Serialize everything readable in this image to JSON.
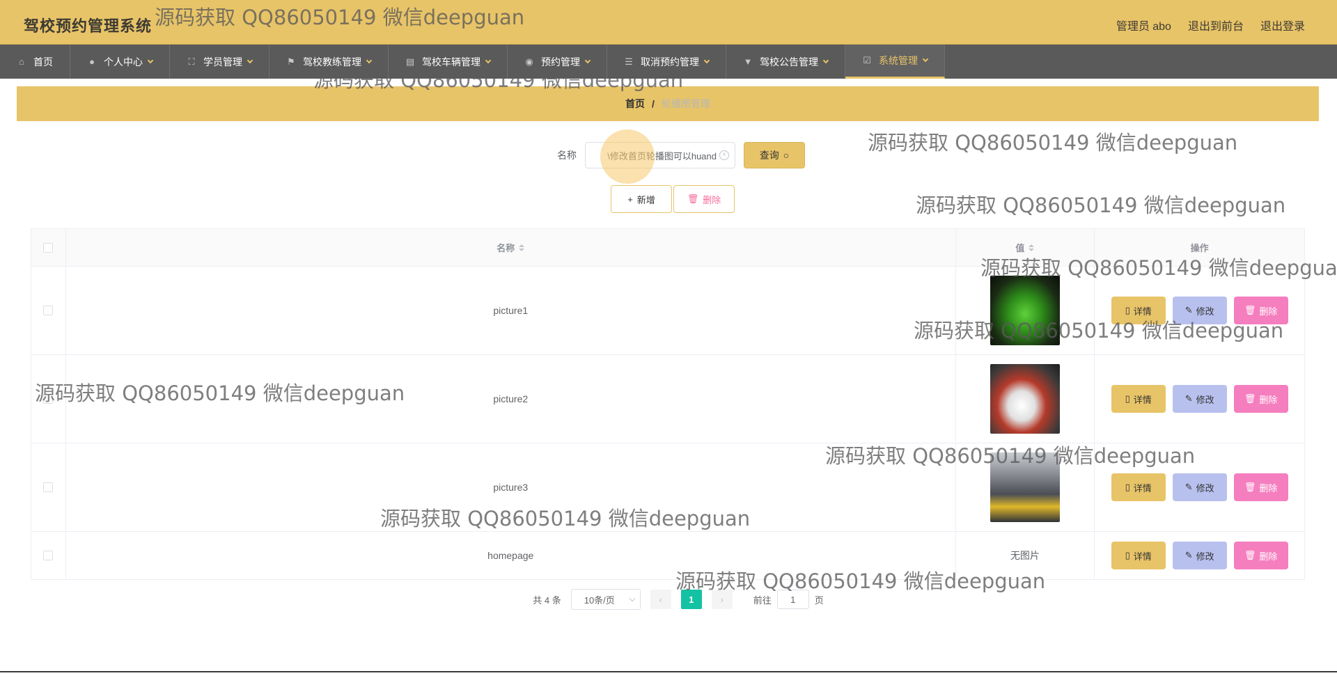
{
  "header": {
    "app_title": "驾校预约管理系统",
    "user_label": "管理员 abo",
    "to_frontend": "退出到前台",
    "logout": "退出登录"
  },
  "nav": {
    "items": [
      {
        "label": "首页",
        "icon": "home-icon",
        "active": false
      },
      {
        "label": "个人中心",
        "icon": "user-icon",
        "active": false
      },
      {
        "label": "学员管理",
        "icon": "frame-icon",
        "active": false
      },
      {
        "label": "驾校教练管理",
        "icon": "flag-icon",
        "active": false
      },
      {
        "label": "驾校车辆管理",
        "icon": "document-icon",
        "active": false
      },
      {
        "label": "预约管理",
        "icon": "location-icon",
        "active": false
      },
      {
        "label": "取消预约管理",
        "icon": "sliders-icon",
        "active": false
      },
      {
        "label": "驾校公告管理",
        "icon": "notice-icon",
        "active": false
      },
      {
        "label": "系统管理",
        "icon": "system-icon",
        "active": true
      }
    ]
  },
  "breadcrumb": {
    "home": "首页",
    "separator": "/",
    "current": "轮播图管理"
  },
  "search": {
    "label": "名称",
    "value": "\\修改首页轮播图可以huand",
    "query_button": "查询"
  },
  "actions": {
    "add": "新增",
    "delete": "删除"
  },
  "table": {
    "columns": {
      "name": "名称",
      "value": "值",
      "operation": "操作"
    },
    "rows": [
      {
        "name": "picture1",
        "value": "image",
        "thumb": "green sports car"
      },
      {
        "name": "picture2",
        "value": "image",
        "thumb": "white race car"
      },
      {
        "name": "picture3",
        "value": "image",
        "thumb": "yellow car on road"
      },
      {
        "name": "homepage",
        "value": "无图片"
      }
    ],
    "row_buttons": {
      "detail": "详情",
      "edit": "修改",
      "delete": "删除"
    }
  },
  "pagination": {
    "total": "共 4 条",
    "page_size": "10条/页",
    "current_page": "1",
    "goto_prefix": "前往",
    "goto_value": "1",
    "goto_suffix": "页"
  },
  "watermark": {
    "text": "源码获取 QQ86050149 微信deepguan"
  },
  "colors": {
    "header_bg": "#e8c468",
    "nav_bg": "#5a5a5a",
    "accent": "#e8c468",
    "edit_btn": "#b8c0ee",
    "delete_btn": "#f57ebf",
    "page_active": "#13c2a2"
  }
}
